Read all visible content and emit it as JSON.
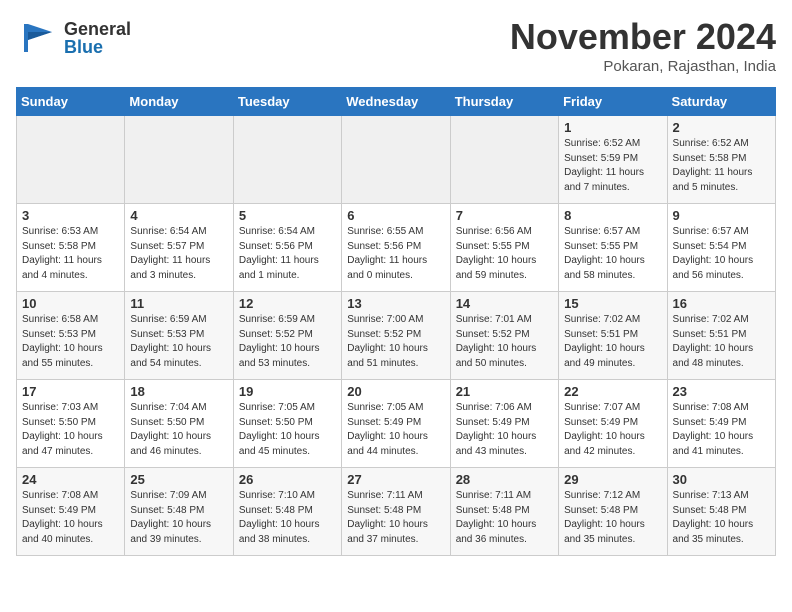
{
  "header": {
    "logo_general": "General",
    "logo_blue": "Blue",
    "month": "November 2024",
    "location": "Pokaran, Rajasthan, India"
  },
  "weekdays": [
    "Sunday",
    "Monday",
    "Tuesday",
    "Wednesday",
    "Thursday",
    "Friday",
    "Saturday"
  ],
  "weeks": [
    [
      {
        "day": "",
        "info": ""
      },
      {
        "day": "",
        "info": ""
      },
      {
        "day": "",
        "info": ""
      },
      {
        "day": "",
        "info": ""
      },
      {
        "day": "",
        "info": ""
      },
      {
        "day": "1",
        "info": "Sunrise: 6:52 AM\nSunset: 5:59 PM\nDaylight: 11 hours and 7 minutes."
      },
      {
        "day": "2",
        "info": "Sunrise: 6:52 AM\nSunset: 5:58 PM\nDaylight: 11 hours and 5 minutes."
      }
    ],
    [
      {
        "day": "3",
        "info": "Sunrise: 6:53 AM\nSunset: 5:58 PM\nDaylight: 11 hours and 4 minutes."
      },
      {
        "day": "4",
        "info": "Sunrise: 6:54 AM\nSunset: 5:57 PM\nDaylight: 11 hours and 3 minutes."
      },
      {
        "day": "5",
        "info": "Sunrise: 6:54 AM\nSunset: 5:56 PM\nDaylight: 11 hours and 1 minute."
      },
      {
        "day": "6",
        "info": "Sunrise: 6:55 AM\nSunset: 5:56 PM\nDaylight: 11 hours and 0 minutes."
      },
      {
        "day": "7",
        "info": "Sunrise: 6:56 AM\nSunset: 5:55 PM\nDaylight: 10 hours and 59 minutes."
      },
      {
        "day": "8",
        "info": "Sunrise: 6:57 AM\nSunset: 5:55 PM\nDaylight: 10 hours and 58 minutes."
      },
      {
        "day": "9",
        "info": "Sunrise: 6:57 AM\nSunset: 5:54 PM\nDaylight: 10 hours and 56 minutes."
      }
    ],
    [
      {
        "day": "10",
        "info": "Sunrise: 6:58 AM\nSunset: 5:53 PM\nDaylight: 10 hours and 55 minutes."
      },
      {
        "day": "11",
        "info": "Sunrise: 6:59 AM\nSunset: 5:53 PM\nDaylight: 10 hours and 54 minutes."
      },
      {
        "day": "12",
        "info": "Sunrise: 6:59 AM\nSunset: 5:52 PM\nDaylight: 10 hours and 53 minutes."
      },
      {
        "day": "13",
        "info": "Sunrise: 7:00 AM\nSunset: 5:52 PM\nDaylight: 10 hours and 51 minutes."
      },
      {
        "day": "14",
        "info": "Sunrise: 7:01 AM\nSunset: 5:52 PM\nDaylight: 10 hours and 50 minutes."
      },
      {
        "day": "15",
        "info": "Sunrise: 7:02 AM\nSunset: 5:51 PM\nDaylight: 10 hours and 49 minutes."
      },
      {
        "day": "16",
        "info": "Sunrise: 7:02 AM\nSunset: 5:51 PM\nDaylight: 10 hours and 48 minutes."
      }
    ],
    [
      {
        "day": "17",
        "info": "Sunrise: 7:03 AM\nSunset: 5:50 PM\nDaylight: 10 hours and 47 minutes."
      },
      {
        "day": "18",
        "info": "Sunrise: 7:04 AM\nSunset: 5:50 PM\nDaylight: 10 hours and 46 minutes."
      },
      {
        "day": "19",
        "info": "Sunrise: 7:05 AM\nSunset: 5:50 PM\nDaylight: 10 hours and 45 minutes."
      },
      {
        "day": "20",
        "info": "Sunrise: 7:05 AM\nSunset: 5:49 PM\nDaylight: 10 hours and 44 minutes."
      },
      {
        "day": "21",
        "info": "Sunrise: 7:06 AM\nSunset: 5:49 PM\nDaylight: 10 hours and 43 minutes."
      },
      {
        "day": "22",
        "info": "Sunrise: 7:07 AM\nSunset: 5:49 PM\nDaylight: 10 hours and 42 minutes."
      },
      {
        "day": "23",
        "info": "Sunrise: 7:08 AM\nSunset: 5:49 PM\nDaylight: 10 hours and 41 minutes."
      }
    ],
    [
      {
        "day": "24",
        "info": "Sunrise: 7:08 AM\nSunset: 5:49 PM\nDaylight: 10 hours and 40 minutes."
      },
      {
        "day": "25",
        "info": "Sunrise: 7:09 AM\nSunset: 5:48 PM\nDaylight: 10 hours and 39 minutes."
      },
      {
        "day": "26",
        "info": "Sunrise: 7:10 AM\nSunset: 5:48 PM\nDaylight: 10 hours and 38 minutes."
      },
      {
        "day": "27",
        "info": "Sunrise: 7:11 AM\nSunset: 5:48 PM\nDaylight: 10 hours and 37 minutes."
      },
      {
        "day": "28",
        "info": "Sunrise: 7:11 AM\nSunset: 5:48 PM\nDaylight: 10 hours and 36 minutes."
      },
      {
        "day": "29",
        "info": "Sunrise: 7:12 AM\nSunset: 5:48 PM\nDaylight: 10 hours and 35 minutes."
      },
      {
        "day": "30",
        "info": "Sunrise: 7:13 AM\nSunset: 5:48 PM\nDaylight: 10 hours and 35 minutes."
      }
    ]
  ]
}
